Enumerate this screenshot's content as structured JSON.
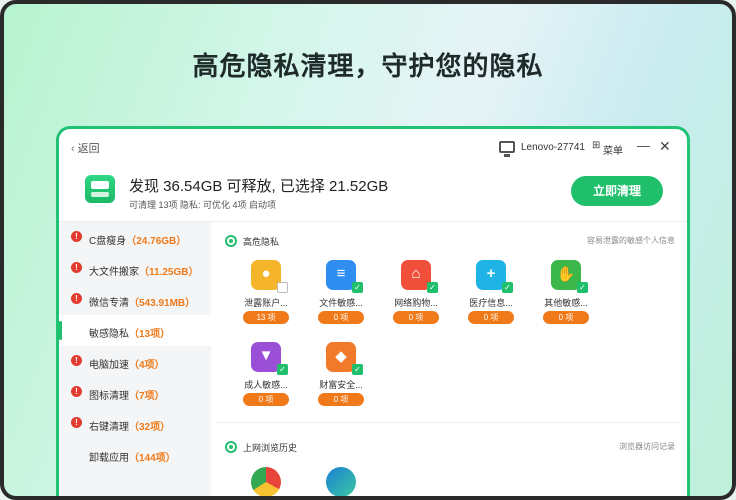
{
  "headline": "高危隐私清理，守护您的隐私",
  "titlebar": {
    "back_label": "返回",
    "computer_name": "Lenovo-27741",
    "menu_label": "菜单"
  },
  "summary": {
    "found_text": "发现 36.54GB 可释放, 已选择 21.52GB",
    "subline": "可清理 13项 隐私: 可优化 4项 启动项",
    "clean_button": "立即清理"
  },
  "sidebar": {
    "items": [
      {
        "label": "C盘瘦身",
        "count": "（24.76GB）",
        "alert": true
      },
      {
        "label": "大文件搬家",
        "count": "（11.25GB）",
        "alert": true
      },
      {
        "label": "微信专清",
        "count": "（543.91MB）",
        "alert": true
      },
      {
        "label": "敏感隐私",
        "count": "（13项）",
        "alert": false,
        "active": true
      },
      {
        "label": "电脑加速",
        "count": "（4项）",
        "alert": true
      },
      {
        "label": "图标清理",
        "count": "（7项）",
        "alert": true
      },
      {
        "label": "右键清理",
        "count": "（32项）",
        "alert": true
      },
      {
        "label": "卸载应用",
        "count": "（144项）",
        "alert": false
      }
    ]
  },
  "section1": {
    "title": "高危隐私",
    "right_text": "容易泄露的敏感个人信息",
    "tiles": [
      {
        "name": "泄露账户...",
        "count": "13 项",
        "checked": false,
        "color": "#f5b52a",
        "glyph": "👤"
      },
      {
        "name": "文件敏感...",
        "count": "0 项",
        "checked": true,
        "color": "#2f8ef0",
        "glyph": "≡"
      },
      {
        "name": "网络购物...",
        "count": "0 项",
        "checked": true,
        "color": "#f0503a",
        "glyph": "⌂"
      },
      {
        "name": "医疗信息...",
        "count": "0 项",
        "checked": true,
        "color": "#1fb3e6",
        "glyph": "+"
      },
      {
        "name": "其他敏感...",
        "count": "0 项",
        "checked": true,
        "color": "#3cb84a",
        "glyph": "✋"
      },
      {
        "name": "成人敏感...",
        "count": "0 项",
        "checked": true,
        "color": "#9b4fd6",
        "glyph": "▼"
      },
      {
        "name": "财富安全...",
        "count": "0 项",
        "checked": true,
        "color": "#f07a2a",
        "glyph": "◆"
      }
    ]
  },
  "section2": {
    "title": "上网浏览历史",
    "right_text": "浏览器访问记录"
  },
  "colors": {
    "accent": "#1fbf6c",
    "alert": "#e33b2f",
    "count": "#f07a1a"
  }
}
